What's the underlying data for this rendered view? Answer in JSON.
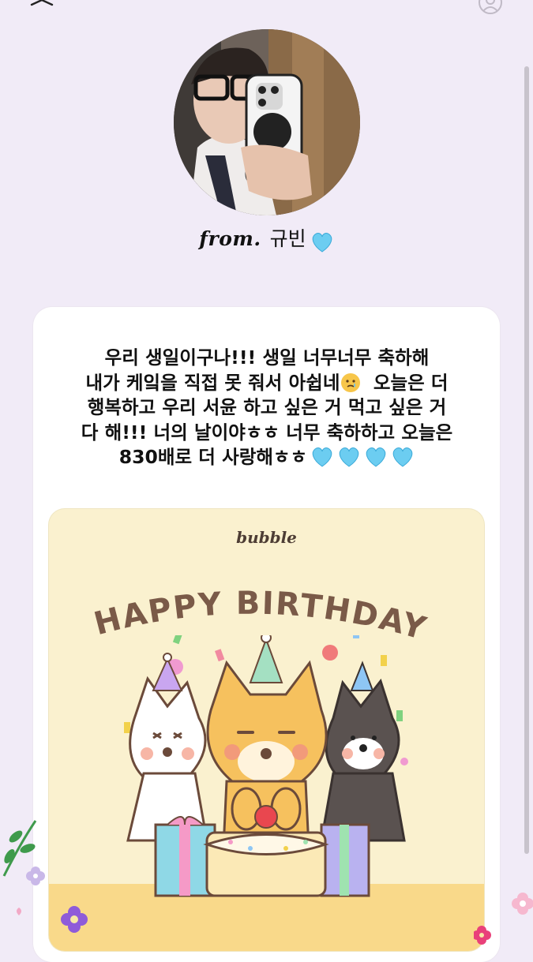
{
  "header": {
    "close_icon": "close-icon",
    "top_right_icon": "profile-icon"
  },
  "profile": {
    "from_label": "from.",
    "name": "규빈"
  },
  "message": {
    "lines": [
      "우리         생일이구나!!! 생일 너무너무 축하해",
      "내가 케잌을 직접 못 줘서 아쉽네",
      "오늘은 더",
      "행복하고 우리 서윤 하고 싶은 거 먹고 싶은 거",
      "다 해!!! 너의 날이야ㅎㅎ 너무 축하하고 오늘은",
      "830배로 더 사랑해ㅎㅎ"
    ]
  },
  "sticker": {
    "brand": "bubble",
    "title": "HAPPY BIRTHDAY!"
  },
  "colors": {
    "background": "#f1ebf7",
    "heart": "#6ccdf1",
    "sticker_bg": "#faf1cf",
    "title": "#7a5a48"
  }
}
